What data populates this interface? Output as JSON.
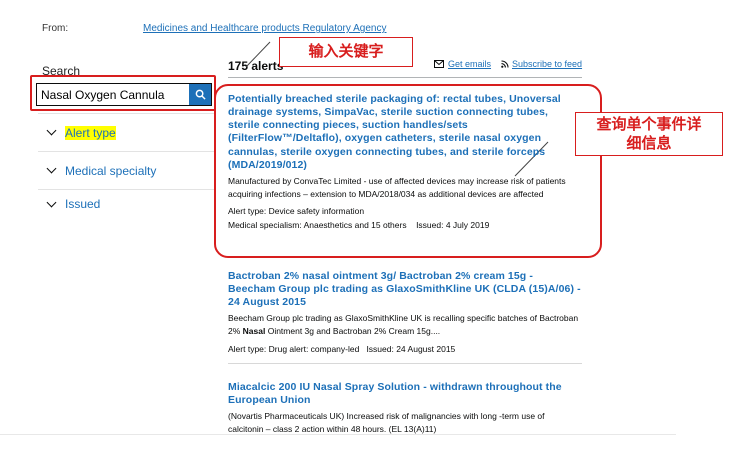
{
  "header": {
    "from_label": "From:",
    "from_link": "Medicines and Healthcare products Regulatory Agency"
  },
  "search": {
    "label": "Search",
    "value": "Nasal Oxygen Cannula",
    "button_icon": "search-icon"
  },
  "facets": [
    {
      "label": "Alert type",
      "highlighted": true
    },
    {
      "label": "Medical specialty",
      "highlighted": false
    },
    {
      "label": "Issued",
      "highlighted": false
    }
  ],
  "results_header": {
    "count": "175 alerts",
    "get_emails": "Get emails",
    "subscribe": "Subscribe to feed"
  },
  "annotations": {
    "keyword": "输入关键字",
    "details_line1": "查询单个事件详",
    "details_line2": "细信息"
  },
  "results": [
    {
      "title": "Potentially breached sterile packaging of: rectal tubes, Unoversal drainage systems, SimpaVac, sterile suction connecting tubes, sterile connecting pieces, suction handles/sets (FilterFlow™/Deltaflo), oxygen catheters, sterile nasal oxygen cannulas, sterile oxygen connecting tubes, and sterile forceps (MDA/2019/012)",
      "description": "Manufactured by ConvaTec Limited - use of affected devices may increase risk of patients acquiring infections – extension to MDA/2018/034 as additional devices are affected",
      "alert_type": "Alert type: Device safety information",
      "specialism": "Medical specialism: Anaesthetics and 15 others",
      "issued": "Issued: 4 July 2019"
    },
    {
      "title": "Bactroban 2% nasal ointment 3g/ Bactroban 2% cream 15g - Beecham Group plc trading as GlaxoSmithKline UK (CLDA (15)A/06) - 24 August 2015",
      "desc_pre": "Beecham Group plc trading as GlaxoSmithKline UK is recalling specific batches of Bactroban 2% ",
      "desc_bold": "Nasal",
      "desc_post": " Ointment 3g and Bactroban 2% Cream 15g....",
      "alert_type": "Alert type: Drug alert: company-led",
      "issued": "Issued: 24 August 2015"
    },
    {
      "title": "Miacalcic 200 IU Nasal Spray Solution - withdrawn throughout the European Union",
      "description": "(Novartis Pharmaceuticals UK) Increased risk of malignancies with long -term use of calcitonin – class 2 action within 48 hours. (EL 13(A)11)"
    }
  ],
  "colors": {
    "link": "#1d70b8",
    "annotation": "#d81e1e",
    "highlight": "#ffff00",
    "search_button": "#1d70b8"
  }
}
